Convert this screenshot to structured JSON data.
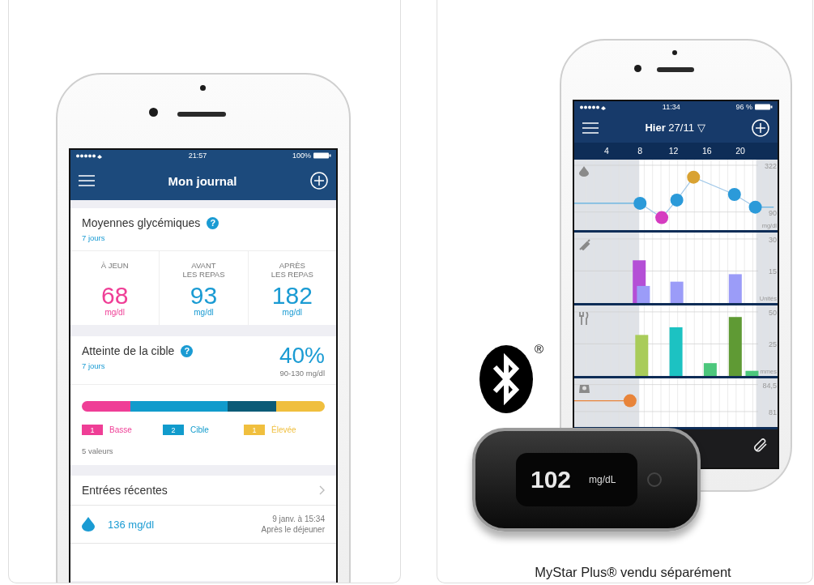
{
  "screenshots": [
    {
      "kind": "journal",
      "status_bar": {
        "time": "21:57",
        "battery": "100%"
      },
      "nav": {
        "title": "Mon journal"
      },
      "averages": {
        "title": "Moyennes glycémiques",
        "help": "?",
        "period": "7 jours",
        "stats": [
          {
            "label": "À JEUN",
            "value": "68",
            "unit": "mg/dl",
            "color": "#ef3e96"
          },
          {
            "label": "AVANT\nLES REPAS",
            "value": "93",
            "unit": "mg/dl",
            "color": "#1a9bd3"
          },
          {
            "label": "APRÈS\nLES REPAS",
            "value": "182",
            "unit": "mg/dl",
            "color": "#1a9bd3"
          }
        ]
      },
      "target": {
        "title": "Atteinte de la cible",
        "help": "?",
        "period": "7 jours",
        "percent": "40%",
        "range": "90-130 mg/dl",
        "segments": [
          {
            "color": "#ef3e96"
          },
          {
            "color": "#119bcc"
          },
          {
            "color": "#0c5b77"
          },
          {
            "color": "#f0bf3e"
          }
        ],
        "legend": [
          {
            "count": "1",
            "label": "Basse",
            "color": "#ef3e96"
          },
          {
            "count": "2",
            "label": "Cible",
            "color": "#119bcc"
          },
          {
            "count": "1",
            "label": "Élevée",
            "color": "#f0bf3e"
          }
        ],
        "total": "5 valeurs"
      },
      "recent": {
        "title": "Entrées récentes",
        "entries": [
          {
            "value": "136 mg/dl",
            "date": "9 janv. à 15:34",
            "context": "Après le déjeuner"
          }
        ]
      }
    },
    {
      "kind": "day",
      "status_bar": {
        "time": "11:34",
        "battery": "96 %"
      },
      "nav": {
        "title": "Hier",
        "date": "27/11 ▽"
      },
      "panels": [
        {
          "kind": "glucose",
          "chart_data": {
            "type": "line",
            "ylabel": "mg/dl",
            "xlim": [
              0,
              24
            ],
            "ylim": [
              0,
              350
            ],
            "xticks": [
              4,
              8,
              12,
              16,
              20
            ],
            "yticks": [
              322,
              90
            ],
            "x": [
              8.0,
              10.6,
              12.4,
              14.4,
              19.3,
              21.8
            ],
            "series": [
              {
                "color": "#9fc7e8",
                "marker": "circle",
                "values": [
                  133,
                  62,
                  149,
                  263,
                  177,
                  114
                ]
              }
            ],
            "ref_lines": [
              {
                "axis": "y",
                "value": 133,
                "color": "#5aaee0"
              },
              {
                "axis": "y",
                "value": 114,
                "color": "#5aaee0"
              }
            ]
          }
        },
        {
          "kind": "insulin",
          "scale": [
            "30",
            "15"
          ],
          "unit": "Unités"
        },
        {
          "kind": "meals",
          "scale": [
            "50",
            "25"
          ],
          "unit": "mmes"
        },
        {
          "kind": "weight",
          "scale": [
            "84,5",
            "81"
          ]
        }
      ],
      "meter": {
        "value": "102",
        "unit": "mg/dL"
      },
      "logo_mark": "®",
      "caption": "MyStar Plus® vendu séparément"
    }
  ]
}
